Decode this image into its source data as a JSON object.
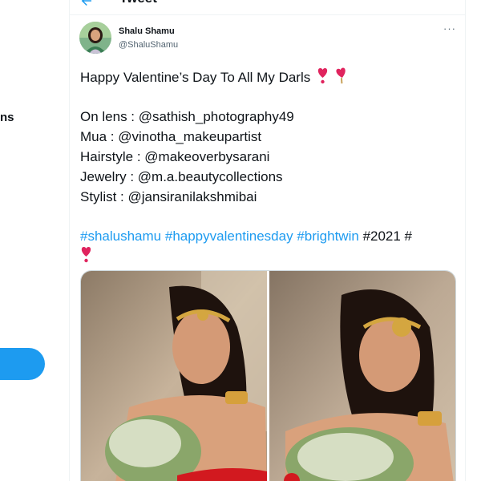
{
  "sidebar": {
    "partial_label": "ns"
  },
  "header": {
    "title": "Tweet"
  },
  "tweet": {
    "display_name": "Shalu Shamu",
    "handle": "@ShaluShamu",
    "more_icon": "more-dots-icon",
    "line1": "Happy Valentine’s Day To All My Darls",
    "credits": [
      "On lens : @sathish_photography49",
      "Mua : @vinotha_makeupartist",
      "Hairstyle : @makeoverbysarani",
      "Jewelry : @m.a.beautycollections",
      "Stylist : @jansiranilakshmibai"
    ],
    "hashtags": [
      "#shalushamu",
      "#happyvalentinesday",
      "#brightwin"
    ],
    "plain_tag": "#2021 #",
    "emoji": "heart-exclamation-icon"
  },
  "colors": {
    "accent": "#1d9bf0",
    "text": "#0f1419",
    "secondary": "#536471",
    "heart": "#e0245e"
  }
}
